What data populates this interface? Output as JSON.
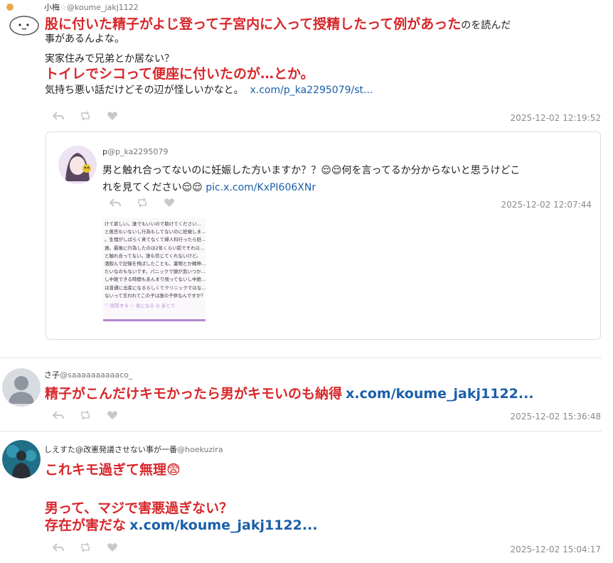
{
  "posts": [
    {
      "author_name": "小梅",
      "author_mark": "☆",
      "author_handle": "@koume_jakj1122",
      "body": {
        "line1_red": "股に付いた精子がよじ登って子宮内に入って授精したって例があった",
        "line1_tail": "のを読んだ",
        "line2": "事があるんよな。",
        "line3": "実家住みで兄弟とか居ない？",
        "line4_red": "トイレでシコって便座に付いたのが…とか。",
        "line5": "気持ち悪い話だけどその辺が怪しいかなと。",
        "link": "x.com/p_ka2295079/st..."
      },
      "timestamp": "2025-12-02 12:19:52",
      "quoted": {
        "author_name": "p",
        "author_handle": "@p_ka2295079",
        "text_line1": "男と触れ合ってないのに妊娠した方いますか？？😌😌何を言ってるか分からないと思うけどこ",
        "text_line2": "れを見てください😌😌",
        "link": "pic.x.com/KxPI606XNr",
        "timestamp": "2025-12-02 12:07:44",
        "image_text": [
          "けて欲しい。誰でもいいので助けてください…",
          "と彼氏もいないし行為もしてないのに妊娠しま…",
          "。生理がしばらく来てなくて婦人科行ったら妊…",
          "週。最後に行為したのは2年くらい前でそれ以…",
          "と触れ合ってない。誰も信じてくれないけど。",
          "酒飲んで記憶を飛ばしたことも、薬物とか精神…",
          "たいなのもないです。パニックで頭が追いつか…",
          "し中絶できる時間もあんまり残ってないし中絶…",
          "は普通に出産になるらしくてクリニックではな…",
          "ないって言われてこの子は誰の子供なんですか？"
        ],
        "image_footer": "♡ 回答する ☆ 気になる ◎ あとで"
      }
    },
    {
      "author_name": "さ子",
      "author_handle": "@saaaaaaaaaaco_",
      "body_red": "精子がこんだけキモかったら男がキモいのも納得",
      "link": "x.com/koume_jakj1122...",
      "timestamp": "2025-12-02 15:36:48"
    },
    {
      "author_name": "しえすた@改憲発議させない事が一番",
      "author_handle": "@hoekuzira",
      "line1_red": "これキモ過ぎて無理😨",
      "line2_red": "男って、マジで害悪過ぎない？",
      "line3_red": "存在が害だな",
      "link": "x.com/koume_jakj1122...",
      "timestamp": "2025-12-02 15:04:17"
    }
  ],
  "icons": [
    "reply-icon",
    "retweet-icon",
    "like-icon"
  ],
  "colors": {
    "red": "#d8262a",
    "link": "#1b5fa8",
    "timestamp": "#8a8a8a"
  }
}
